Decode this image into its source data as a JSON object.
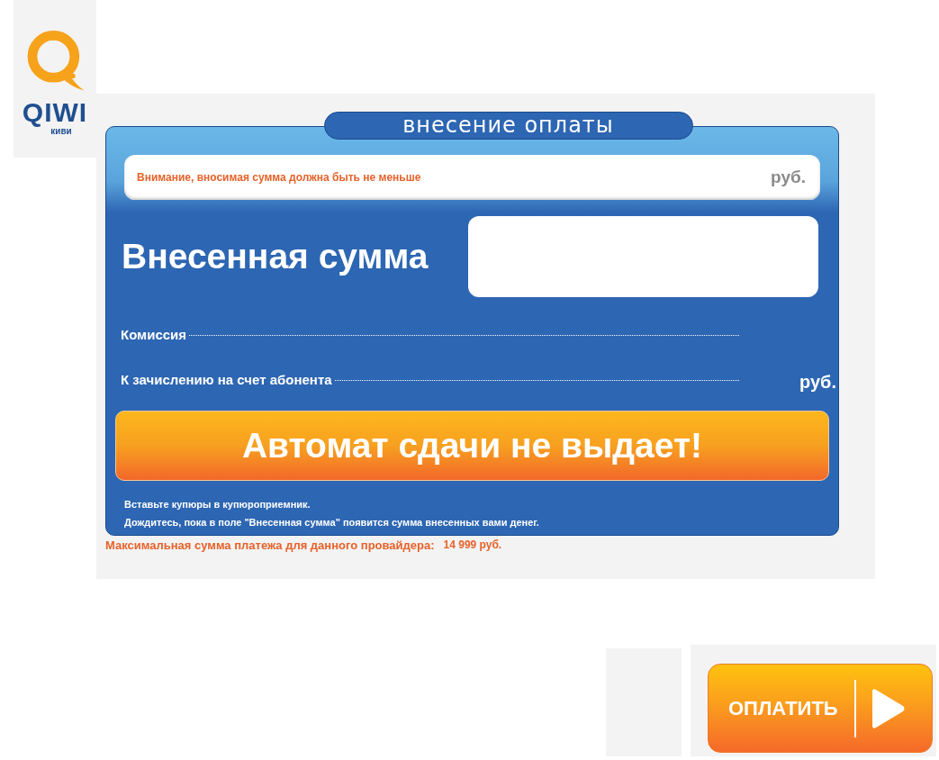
{
  "logo": {
    "wordmark": "QIWI",
    "subtitle": "киви"
  },
  "title": "внесение оплаты",
  "notice": {
    "text": "Внимание, вносимая сумма должна быть не меньше",
    "currency": "руб."
  },
  "amount": {
    "label": "Внесенная сумма"
  },
  "rows": [
    {
      "label": "Комиссия"
    },
    {
      "label": "К зачислению на счет абонента",
      "currency": "руб."
    }
  ],
  "change_warning": "Автомат сдачи не выдает!",
  "instructions": [
    "Вставьте купюры в купюроприемник.",
    "Дождитесь, пока в поле \"Внесенная сумма\" появится сумма внесенных вами денег."
  ],
  "limit": {
    "label": "Максимальная сумма платежа для данного провайдера:",
    "value": "14 999 руб."
  },
  "pay_button": {
    "label": "ОПЛАТИТЬ"
  }
}
